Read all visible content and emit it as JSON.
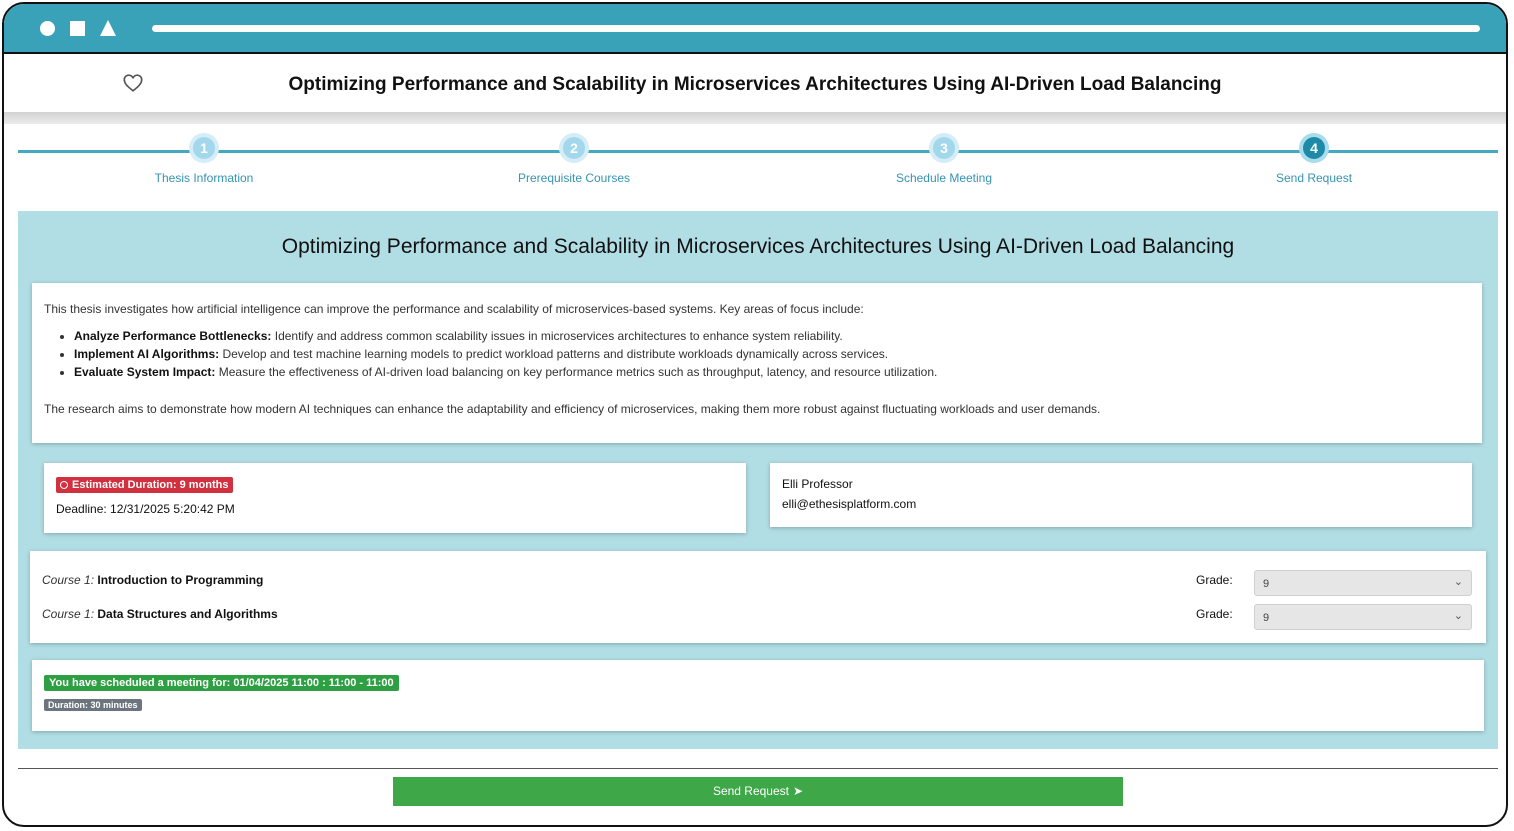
{
  "header": {
    "title": "Optimizing Performance and Scalability in Microservices Architectures Using AI-Driven Load Balancing"
  },
  "steps": [
    {
      "number": "1",
      "label": "Thesis Information"
    },
    {
      "number": "2",
      "label": "Prerequisite Courses"
    },
    {
      "number": "3",
      "label": "Schedule Meeting"
    },
    {
      "number": "4",
      "label": "Send Request"
    }
  ],
  "active_step": 4,
  "thesis": {
    "title": "Optimizing Performance and Scalability in Microservices Architectures Using AI-Driven Load Balancing",
    "intro": "This thesis investigates how artificial intelligence can improve the performance and scalability of microservices-based systems. Key areas of focus include:",
    "bullets": [
      {
        "bold": "Analyze Performance Bottlenecks:",
        "text": " Identify and address common scalability issues in microservices architectures to enhance system reliability."
      },
      {
        "bold": "Implement AI Algorithms:",
        "text": " Develop and test machine learning models to predict workload patterns and distribute workloads dynamically across services."
      },
      {
        "bold": "Evaluate System Impact:",
        "text": " Measure the effectiveness of AI-driven load balancing on key performance metrics such as throughput, latency, and resource utilization."
      }
    ],
    "conclusion": "The research aims to demonstrate how modern AI techniques can enhance the adaptability and efficiency of microservices, making them more robust against fluctuating workloads and user demands."
  },
  "duration_badge": "Estimated Duration: 9 months",
  "deadline": "Deadline: 12/31/2025 5:20:42 PM",
  "professor": {
    "name": "Elli Professor",
    "email": "elli@ethesisplatform.com"
  },
  "courses": [
    {
      "prefix": "Course 1:",
      "name": "Introduction to Programming",
      "grade_label": "Grade:",
      "grade": "9"
    },
    {
      "prefix": "Course 1:",
      "name": "Data Structures and Algorithms",
      "grade_label": "Grade:",
      "grade": "9"
    }
  ],
  "meeting": {
    "scheduled": "You have scheduled a meeting for: 01/04/2025 11:00 : 11:00 - 11:00",
    "duration": "Duration: 30 minutes"
  },
  "send_button": "Send Request",
  "colors": {
    "chrome": "#3aa2b8",
    "panel": "#b1dde4",
    "step_line": "#45a8c3",
    "duration_badge": "#d1313f",
    "meeting_badge": "#2ea043",
    "send_button": "#3ea849"
  }
}
